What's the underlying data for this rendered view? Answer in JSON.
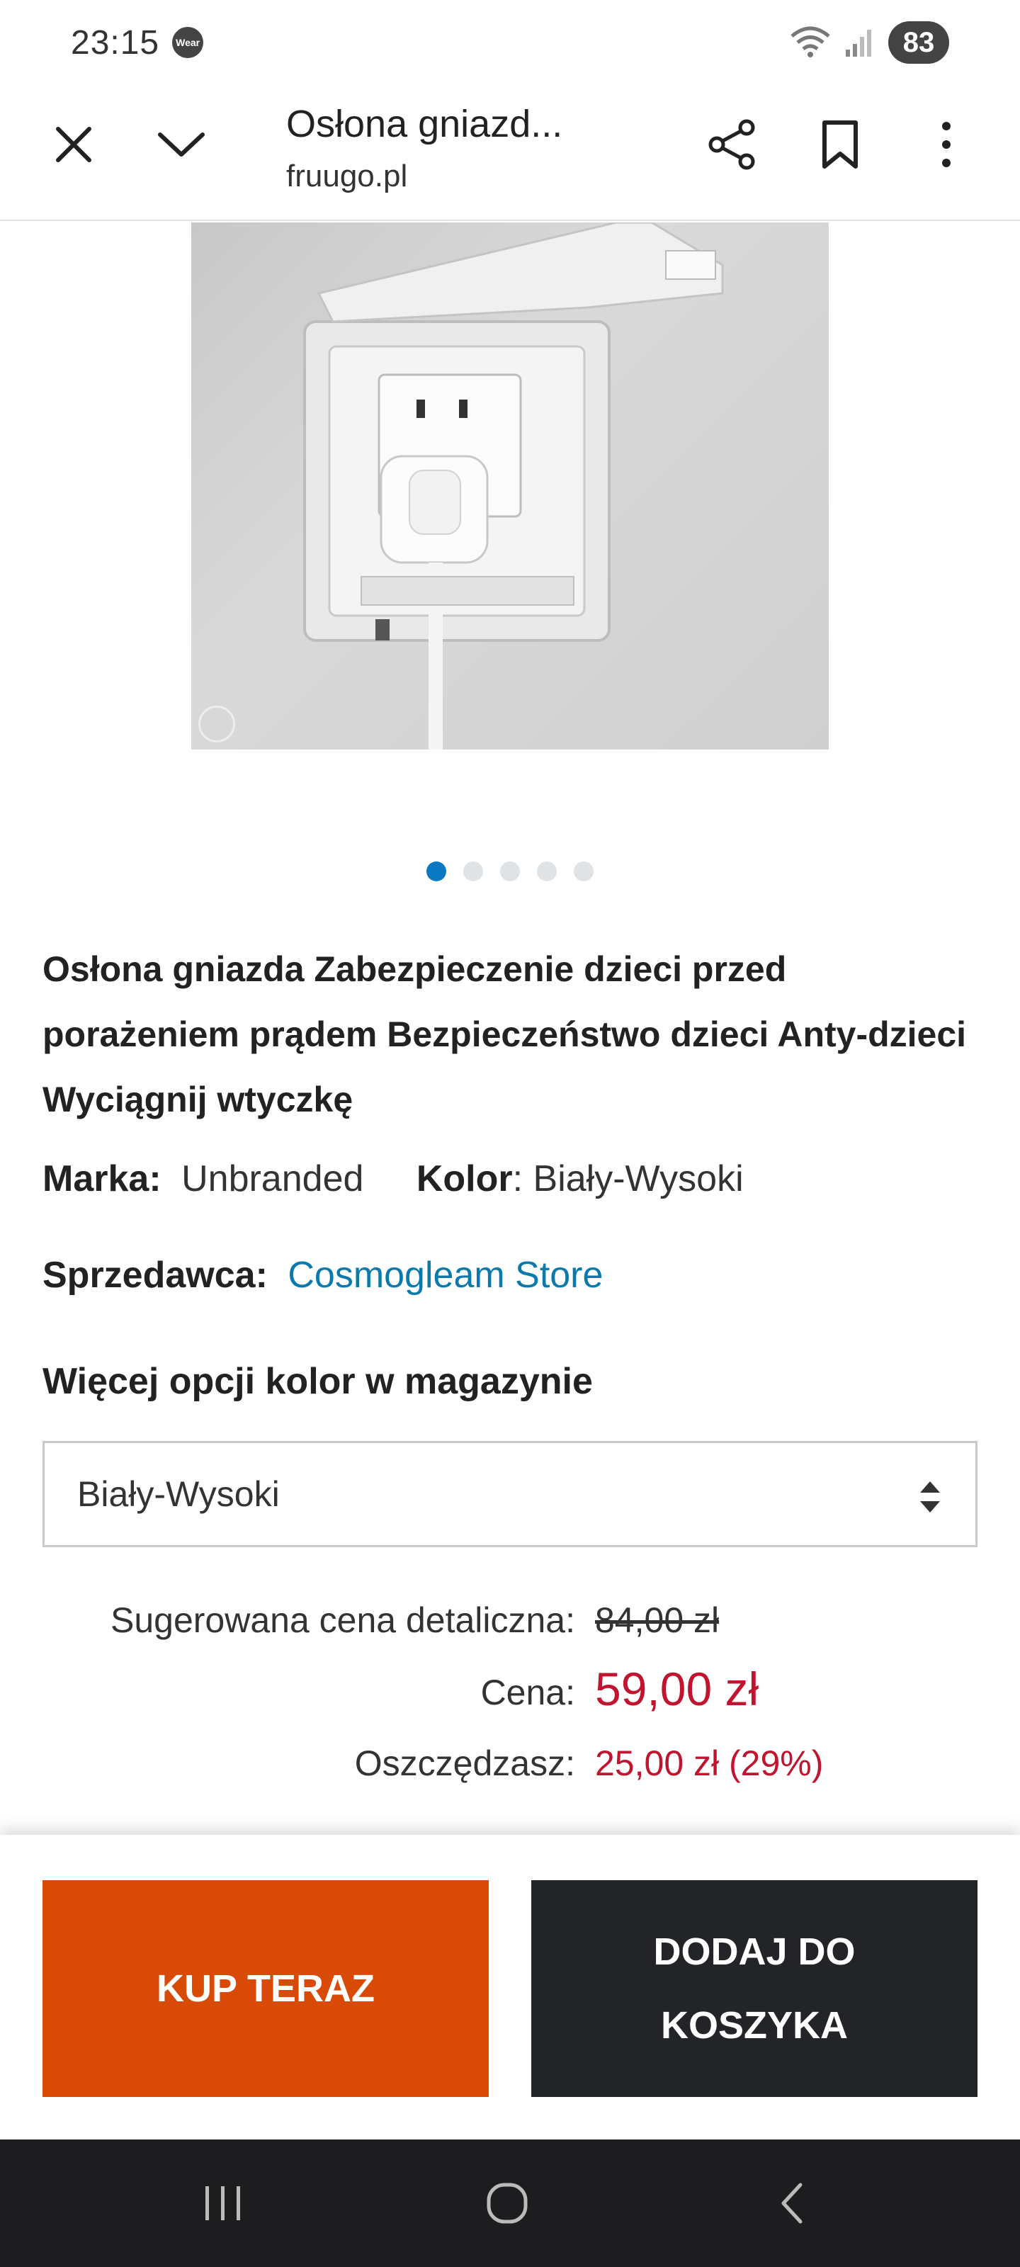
{
  "status_bar": {
    "time": "23:15",
    "wear_label": "Wear",
    "battery": "83"
  },
  "browser": {
    "tab_title": "Osłona gniazd...",
    "domain": "fruugo.pl"
  },
  "product": {
    "title": "Osłona gniazda Zabezpieczenie dzieci przed porażeniem prądem Bezpieczeństwo dzieci Anty-dzieci Wyciągnij wtyczkę",
    "brand_label": "Marka:",
    "brand_value": "Unbranded",
    "color_label": "Kolor",
    "color_value": ": Biały-Wysoki",
    "seller_label": "Sprzedawca:",
    "seller_value": "Cosmogleam Store",
    "options_title": "Więcej opcji kolor w magazynie",
    "selected_option": "Biały-Wysoki"
  },
  "carousel": {
    "total": 5,
    "active_index": 0
  },
  "pricing": {
    "rrp_label": "Sugerowana cena detaliczna:",
    "rrp_value": "84,00 zł",
    "price_label": "Cena:",
    "price_value": "59,00 zł",
    "save_label": "Oszczędzasz:",
    "save_value": "25,00 zł (29%)"
  },
  "actions": {
    "buy_now": "KUP TERAZ",
    "add_to_cart": "DODAJ DO KOSZYKA"
  },
  "colors": {
    "accent_link": "#0a79ab",
    "price_red": "#c0142f",
    "buy_orange": "#d94a06",
    "cart_dark": "#222428"
  }
}
